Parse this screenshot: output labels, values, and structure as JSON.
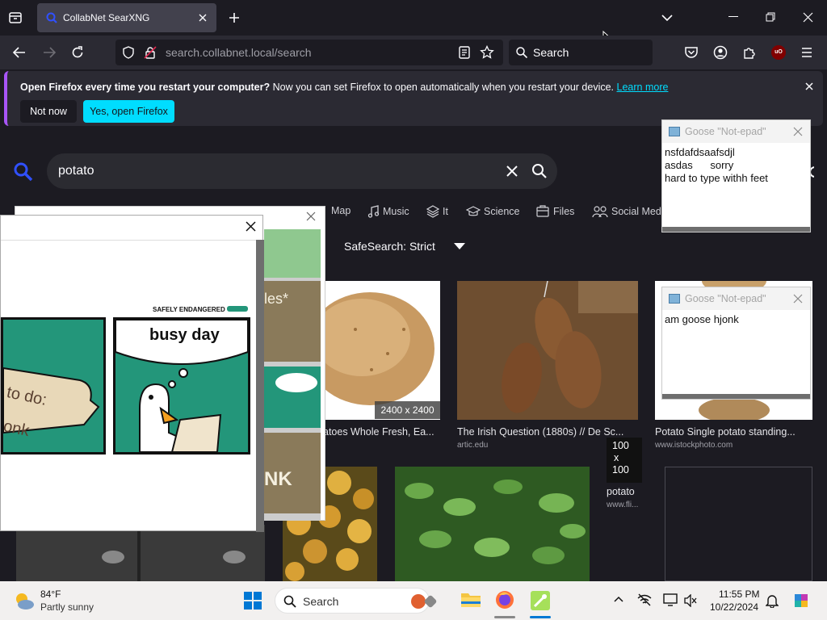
{
  "browser": {
    "tab_title": "CollabNet SearXNG",
    "url_host": "search.collabnet.local",
    "url_path": "/search",
    "search_placeholder": "Search"
  },
  "notification": {
    "bold": "Open Firefox every time you restart your computer?",
    "text": " Now you can set Firefox to open automatically when you restart your device. ",
    "link": "Learn more",
    "not_now": "Not now",
    "yes_open": "Yes, open Firefox"
  },
  "searx": {
    "query": "potato",
    "categories": [
      "Map",
      "Music",
      "It",
      "Science",
      "Files",
      "Social Medi"
    ],
    "safesearch": "SafeSearch: Strict",
    "results": [
      {
        "size": "2400 x 2400",
        "caption": "atoes Whole Fresh, Ea...",
        "source": ""
      },
      {
        "caption": "The Irish Question (1880s) // De Sc...",
        "source": "artic.edu"
      },
      {
        "caption": "Potato Single potato standing...",
        "source": "www.istockphoto.com"
      },
      {
        "size_a": "100",
        "size_b": "x",
        "size_c": "100",
        "caption": "potato",
        "source": "www.fli..."
      }
    ]
  },
  "goose_windows": {
    "title": "Goose \"Not-epad\"",
    "note1": "nsfdafdsaafsdjl\nasdas      sorry\nhard to type withh feet",
    "note2": "am goose hjonk"
  },
  "meme": {
    "top_label": "SAFELY ENDANGERED",
    "panel_text": "busy day",
    "scroll_text_a": "to do:",
    "scroll_text_b": "onk",
    "peek_a": "les*",
    "peek_b": "NK"
  },
  "taskbar": {
    "temp": "84°F",
    "weather": "Partly sunny",
    "search_placeholder": "Search",
    "time": "11:55 PM",
    "date": "10/22/2024"
  },
  "colors": {
    "accent": "#00ddff",
    "searx_blue": "#3050ff",
    "goose_green": "#23967a"
  }
}
